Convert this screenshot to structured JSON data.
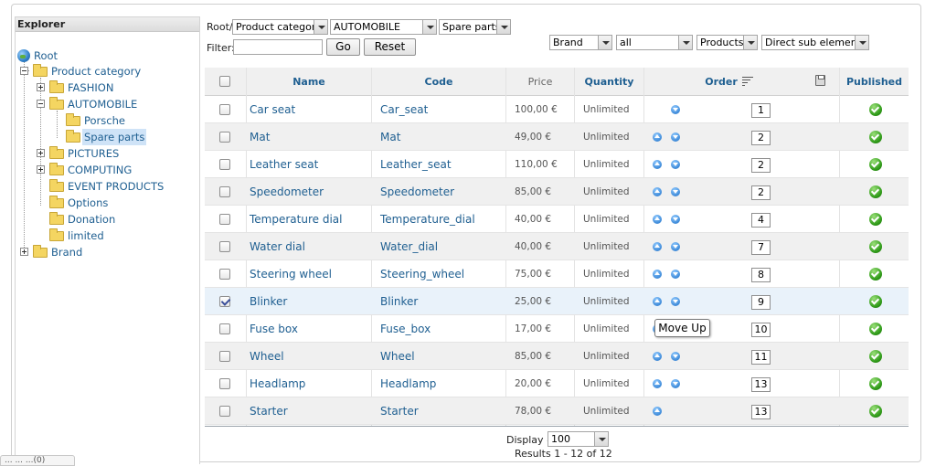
{
  "explorer": {
    "title": "Explorer",
    "root": "Root",
    "nodes": {
      "product_category": "Product category",
      "fashion": "FASHION",
      "automobile": "AUTOMOBILE",
      "porsche": "Porsche",
      "spare_parts": "Spare parts",
      "pictures": "PICTURES",
      "computing": "COMPUTING",
      "event_products": "EVENT PRODUCTS",
      "options": "Options",
      "donation": "Donation",
      "limited": "limited",
      "brand": "Brand"
    }
  },
  "toolbar": {
    "breadcrumb_root": "Root/",
    "select_category": "Product category",
    "select_automobile": "AUTOMOBILE",
    "select_spare_parts": "Spare parts",
    "filter_label": "Filter:",
    "filter_value": "",
    "go_label": "Go",
    "reset_label": "Reset",
    "select_brand": "Brand",
    "select_all": "all",
    "select_products": "Products",
    "select_direct": "Direct sub elements"
  },
  "table": {
    "headers": {
      "name": "Name",
      "code": "Code",
      "price": "Price",
      "quantity": "Quantity",
      "order": "Order",
      "published": "Published"
    },
    "rows": [
      {
        "name": "Car seat",
        "code": "Car_seat",
        "price": "100,00 €",
        "quantity": "Unlimited",
        "order": "1",
        "checked": false
      },
      {
        "name": "Mat",
        "code": "Mat",
        "price": "49,00 €",
        "quantity": "Unlimited",
        "order": "2",
        "checked": false
      },
      {
        "name": "Leather seat",
        "code": "Leather_seat",
        "price": "110,00 €",
        "quantity": "Unlimited",
        "order": "2",
        "checked": false
      },
      {
        "name": "Speedometer",
        "code": "Speedometer",
        "price": "85,00 €",
        "quantity": "Unlimited",
        "order": "2",
        "checked": false
      },
      {
        "name": "Temperature dial",
        "code": "Temperature_dial",
        "price": "40,00 €",
        "quantity": "Unlimited",
        "order": "4",
        "checked": false
      },
      {
        "name": "Water dial",
        "code": "Water_dial",
        "price": "40,00 €",
        "quantity": "Unlimited",
        "order": "7",
        "checked": false
      },
      {
        "name": "Steering wheel",
        "code": "Steering_wheel",
        "price": "75,00 €",
        "quantity": "Unlimited",
        "order": "8",
        "checked": false
      },
      {
        "name": "Blinker",
        "code": "Blinker",
        "price": "25,00 €",
        "quantity": "Unlimited",
        "order": "9",
        "checked": true
      },
      {
        "name": "Fuse box",
        "code": "Fuse_box",
        "price": "17,00 €",
        "quantity": "Unlimited",
        "order": "10",
        "checked": false
      },
      {
        "name": "Wheel",
        "code": "Wheel",
        "price": "85,00 €",
        "quantity": "Unlimited",
        "order": "11",
        "checked": false
      },
      {
        "name": "Headlamp",
        "code": "Headlamp",
        "price": "20,00 €",
        "quantity": "Unlimited",
        "order": "13",
        "checked": false
      },
      {
        "name": "Starter",
        "code": "Starter",
        "price": "78,00 €",
        "quantity": "Unlimited",
        "order": "13",
        "checked": false
      }
    ]
  },
  "tooltip": "Move Up",
  "footer": {
    "display_label": "Display #",
    "display_value": "100",
    "results": "Results 1 - 12 of 12"
  },
  "bottom_tab": "... ... ...(0)"
}
